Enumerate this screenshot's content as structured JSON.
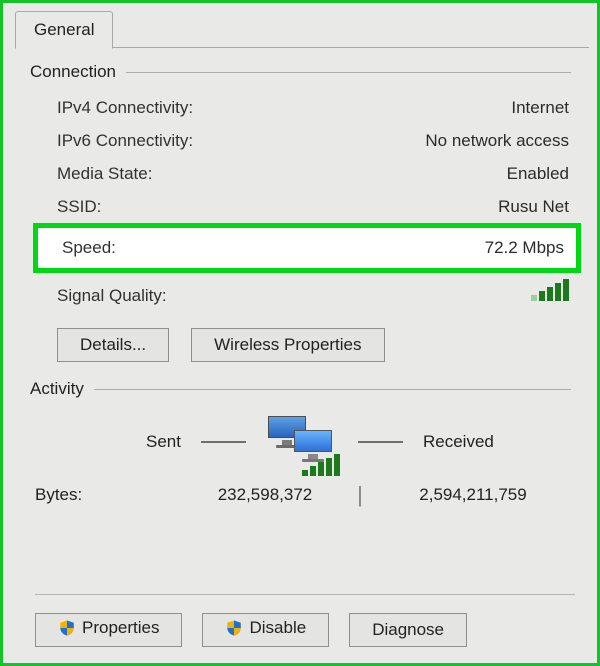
{
  "tab": {
    "label": "General"
  },
  "connection": {
    "header": "Connection",
    "rows": {
      "ipv4": {
        "label": "IPv4 Connectivity:",
        "value": "Internet"
      },
      "ipv6": {
        "label": "IPv6 Connectivity:",
        "value": "No network access"
      },
      "media": {
        "label": "Media State:",
        "value": "Enabled"
      },
      "ssid": {
        "label": "SSID:",
        "value": "Rusu Net"
      }
    },
    "speed": {
      "label": "Speed:",
      "value": "72.2 Mbps"
    },
    "signal": {
      "label": "Signal Quality:"
    },
    "buttons": {
      "details": "Details...",
      "wireless": "Wireless Properties"
    }
  },
  "activity": {
    "header": "Activity",
    "sent_label": "Sent",
    "received_label": "Received",
    "bytes_label": "Bytes:",
    "sent_bytes": "232,598,372",
    "received_bytes": "2,594,211,759"
  },
  "bottom": {
    "properties": "Properties",
    "disable": "Disable",
    "diagnose": "Diagnose"
  }
}
